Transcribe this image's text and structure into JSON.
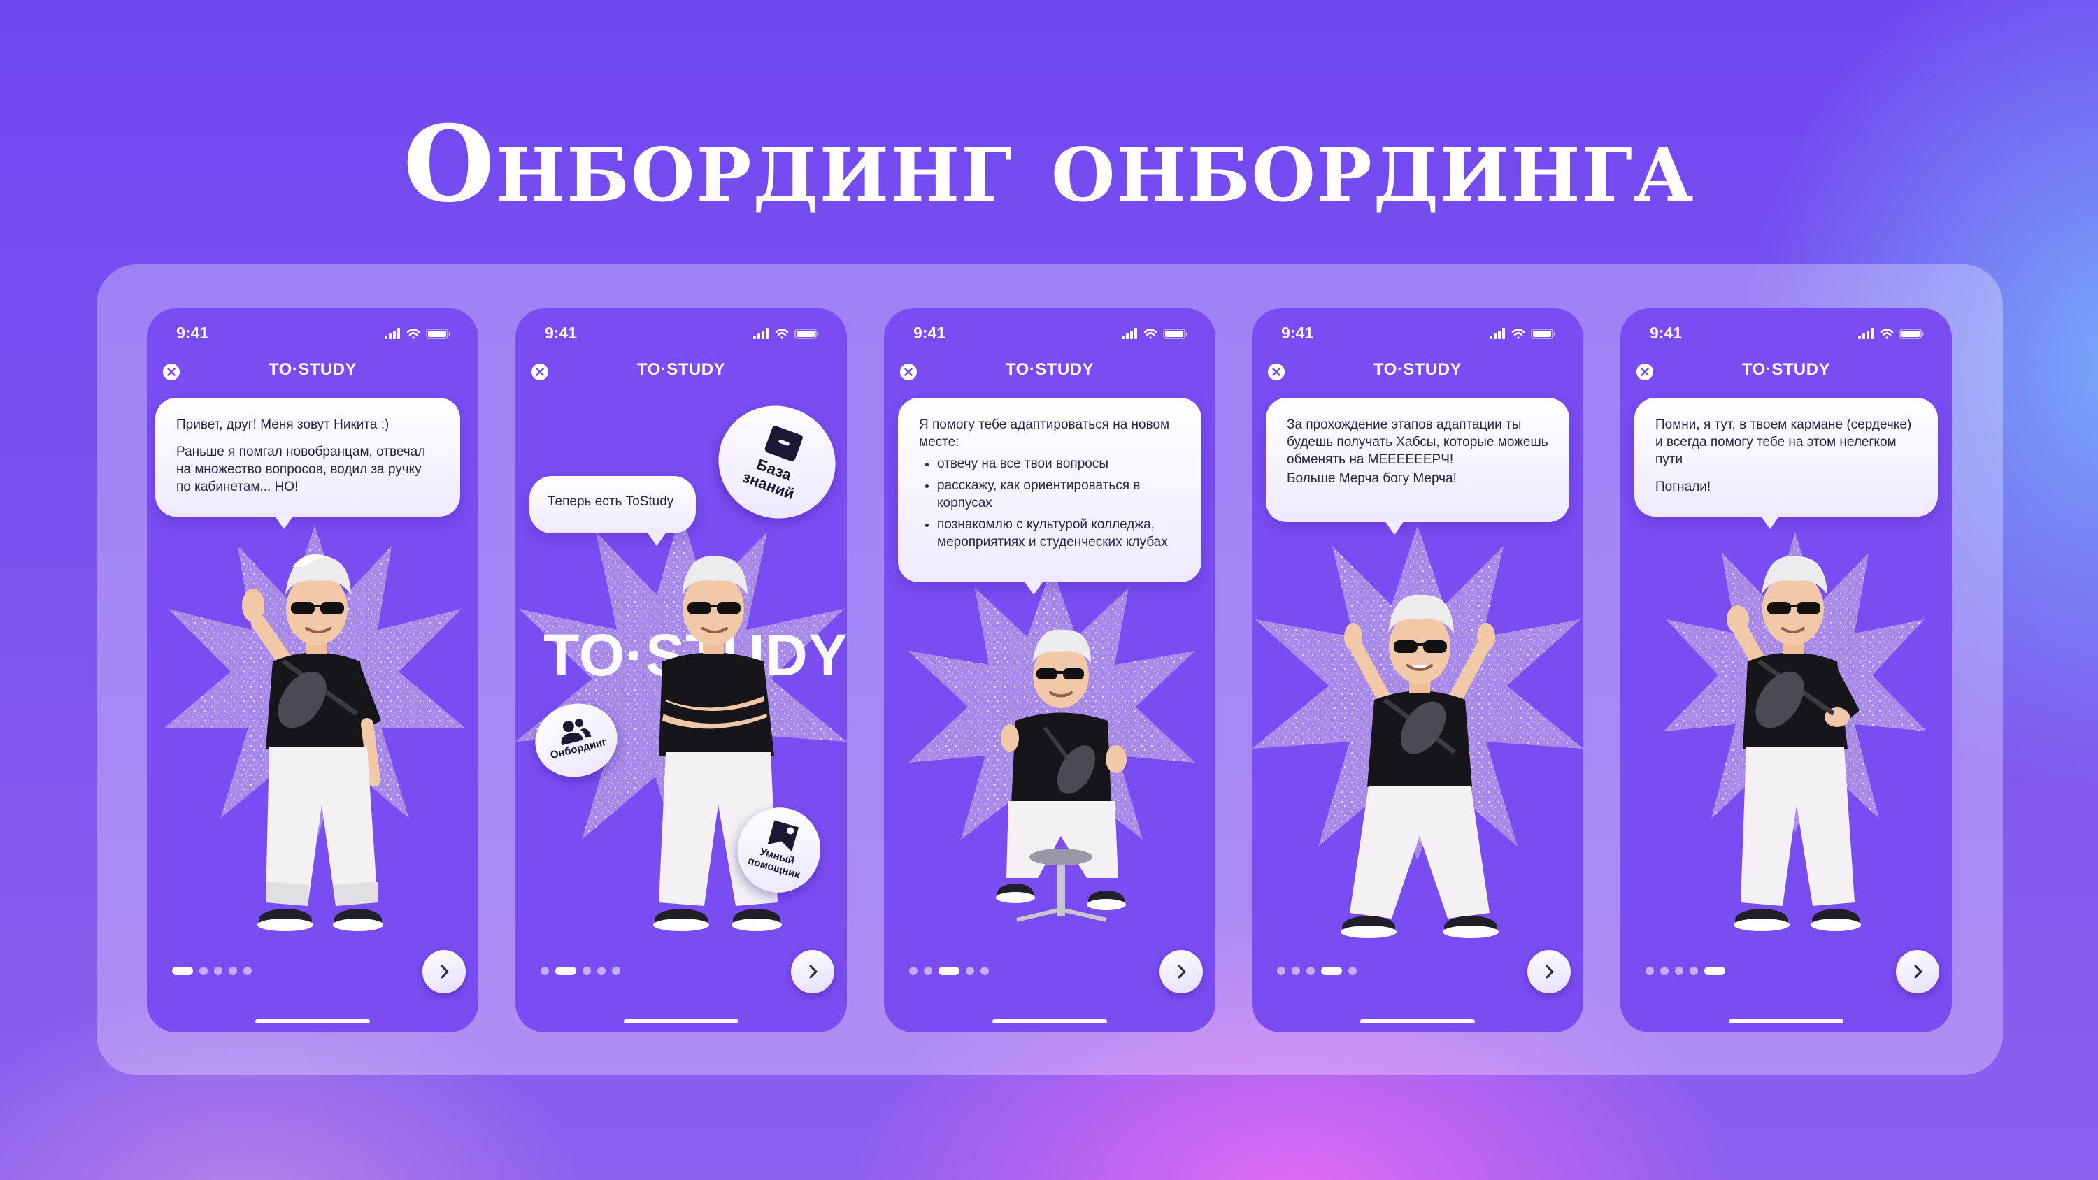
{
  "title": "Онбординг онбординга",
  "status_bar": {
    "time": "9:41"
  },
  "header": {
    "brand": "TO·STUDY"
  },
  "screens": [
    {
      "messages": [
        "Привет, друг!  Меня зовут Никита :)",
        "Раньше я помгал новобранцам, отвечал на множество вопросов, водил за ручку по кабинетам... НО!"
      ],
      "active_dot": 1
    },
    {
      "message": "Теперь есть ToStudy",
      "big_brand": "TO·STUDY",
      "tags": {
        "knowledge": "База знаний",
        "onboarding": "Онбординг",
        "assistant": "Умный помощник"
      },
      "active_dot": 2
    },
    {
      "intro": "Я помогу тебе адаптироваться на новом месте:",
      "bullets": [
        "отвечу на все твои вопросы",
        "расскажу, как ориентироваться в корпусах",
        "познакомлю с культурой колледжа, мероприятиях и студенческих клубах"
      ],
      "active_dot": 3
    },
    {
      "messages": [
        "За прохождение этапов адаптации ты будешь получать Хабсы, которые можешь обменять на МЕЕЕЕЕЕРЧ!",
        "Больше Мерча богу Мерча!"
      ],
      "active_dot": 4
    },
    {
      "messages": [
        "Помни, я тут, в твоем кармане (сердечке) и всегда помогу тебе на этом нелегком пути",
        "Погнали!"
      ],
      "active_dot": 5
    }
  ],
  "colors": {
    "screen_bg": "#7a4df2",
    "burst": "#a78ae8",
    "accent_text": "#ffffff",
    "bubble_text": "#2a2244"
  },
  "icons": {
    "close": "close-circle-icon",
    "next": "chevron-right-icon",
    "signal": "cellular-signal-icon",
    "wifi": "wifi-icon",
    "battery": "battery-icon"
  }
}
